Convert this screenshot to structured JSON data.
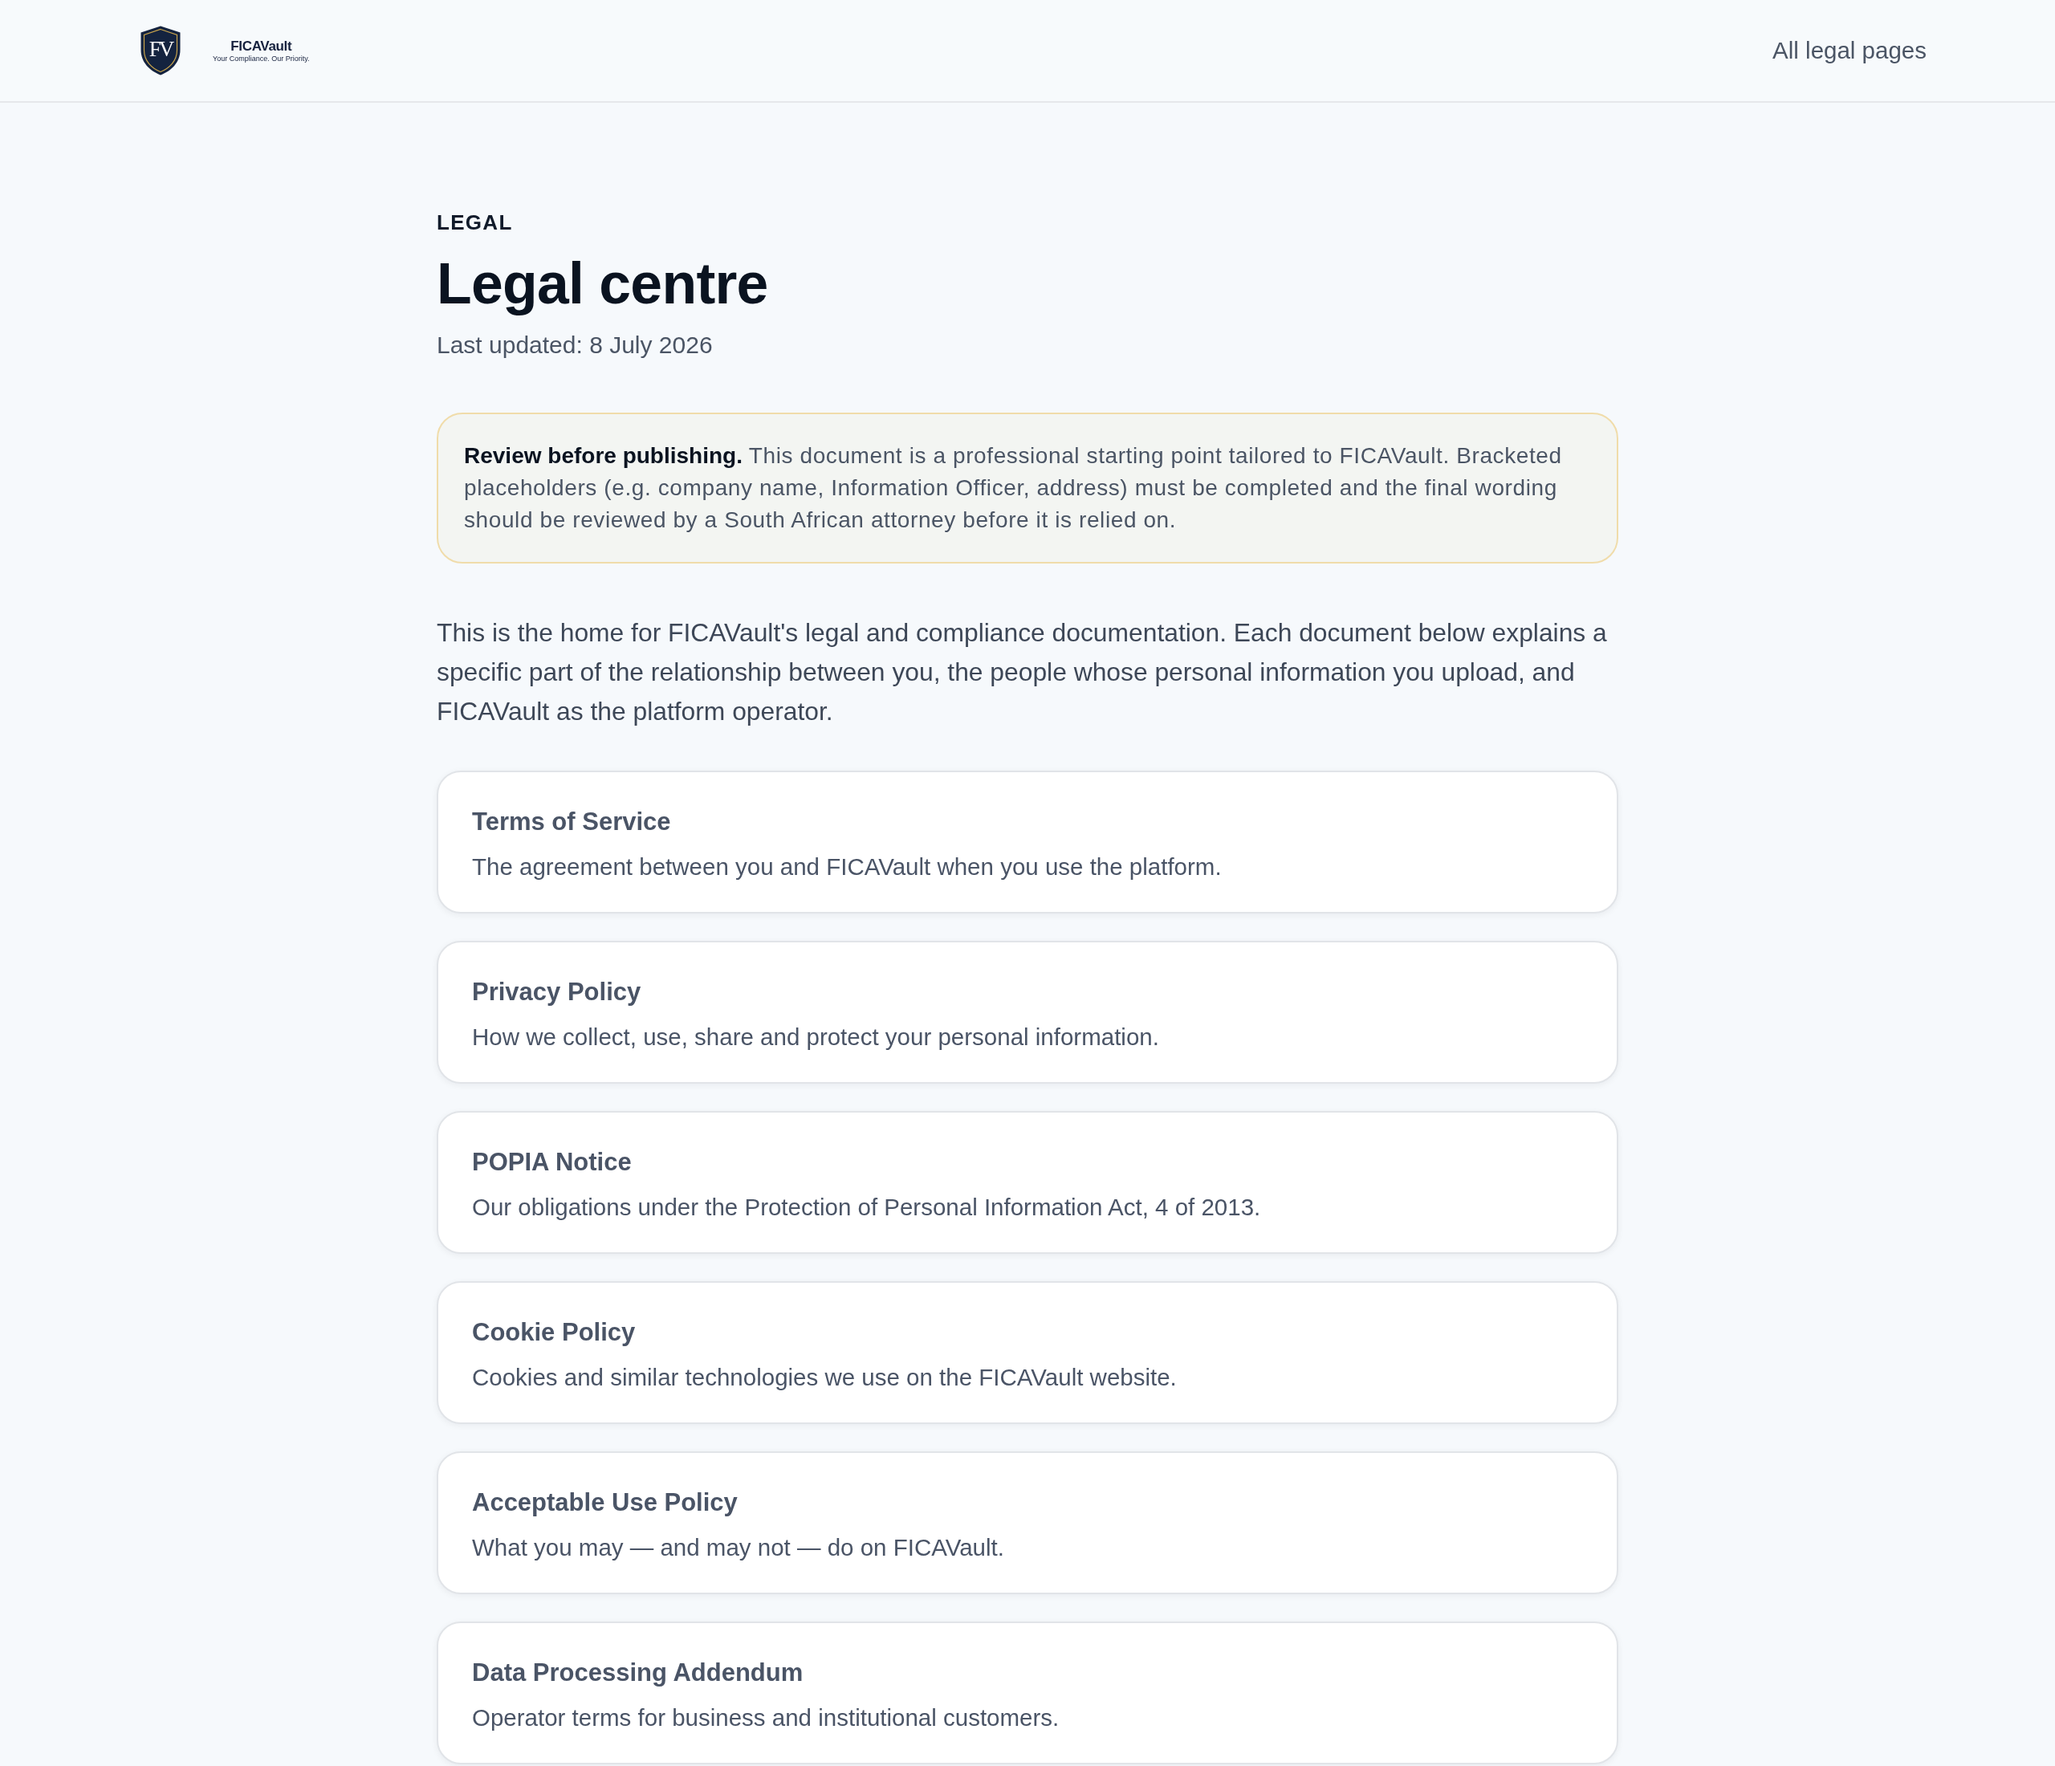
{
  "header": {
    "logo": {
      "monogram": "FV",
      "name": "FICAVault",
      "tagline": "Your Compliance. Our Priority."
    },
    "nav_link": "All legal pages"
  },
  "page": {
    "eyebrow": "LEGAL",
    "title": "Legal centre",
    "last_updated": "Last updated: 8 July 2026"
  },
  "notice": {
    "text": "**Review before publishing.** This document is a professional starting point tailored to FICAVault. Bracketed placeholders (e.g. company name, Information Officer, address) must be completed and the final wording should be reviewed by a South African attorney before it is relied on."
  },
  "intro": "This is the home for FICAVault's legal and compliance documentation. Each document below explains a specific part of the relationship between you, the people whose personal information you upload, and FICAVault as the platform operator.",
  "documents": [
    {
      "title": "Terms of Service",
      "description": "The agreement between you and FICAVault when you use the platform."
    },
    {
      "title": "Privacy Policy",
      "description": "How we collect, use, share and protect your personal information."
    },
    {
      "title": "POPIA Notice",
      "description": "Our obligations under the Protection of Personal Information Act, 4 of 2013."
    },
    {
      "title": "Cookie Policy",
      "description": "Cookies and similar technologies we use on the FICAVault website."
    },
    {
      "title": "Acceptable Use Policy",
      "description": "What you may — and may not — do on FICAVault."
    },
    {
      "title": "Data Processing Addendum",
      "description": "Operator terms for business and institutional customers."
    }
  ]
}
